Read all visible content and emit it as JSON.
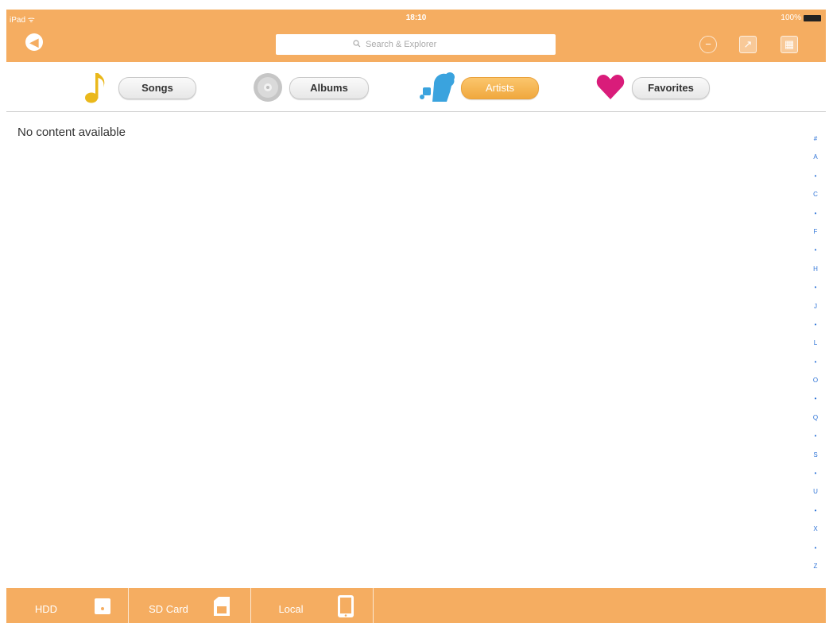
{
  "status_bar": {
    "carrier": "iPad ",
    "wifi_icon": "wifi-icon",
    "time": "18:10",
    "battery": "100%"
  },
  "nav": {
    "back_icon": "back-arrow-icon",
    "search_placeholder": "Search & Explorer",
    "right_icons": [
      "minus-circle-icon",
      "share-icon",
      "grid-icon"
    ]
  },
  "categories": [
    {
      "label": "Songs",
      "icon": "music-note-icon",
      "active": false
    },
    {
      "label": "Albums",
      "icon": "cd-disc-icon",
      "active": false
    },
    {
      "label": "Artists",
      "icon": "artist-silhouette-icon",
      "active": true
    },
    {
      "label": "Favorites",
      "icon": "heart-icon",
      "active": false
    }
  ],
  "main": {
    "empty_message": "No content available"
  },
  "alpha_index": [
    "#",
    "A",
    "•",
    "C",
    "•",
    "F",
    "•",
    "H",
    "•",
    "J",
    "•",
    "L",
    "•",
    "O",
    "•",
    "Q",
    "•",
    "S",
    "•",
    "U",
    "•",
    "X",
    "•",
    "Z"
  ],
  "sources": [
    {
      "label": "HDD",
      "icon": "hdd-icon"
    },
    {
      "label": "SD Card",
      "icon": "sd-card-icon"
    },
    {
      "label": "Local",
      "icon": "tablet-icon"
    }
  ],
  "colors": {
    "accent": "#f5ad61",
    "active_tab": "#f0a83e",
    "index_blue": "#2d73d7",
    "heart": "#d91c7a",
    "note": "#eab81b",
    "artist_blue": "#3aa3de"
  }
}
